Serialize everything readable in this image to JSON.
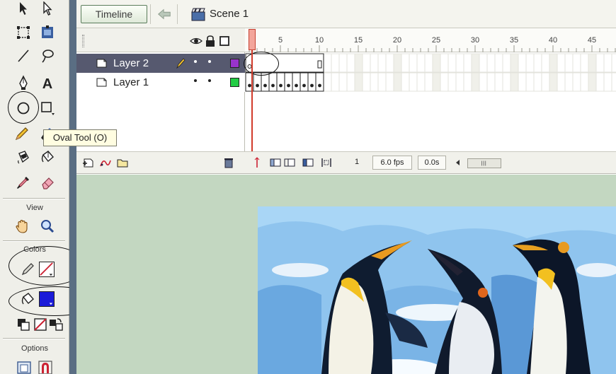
{
  "header": {
    "timeline_button": "Timeline",
    "scene_label": "Scene 1"
  },
  "tools": {
    "items": [
      {
        "name": "arrow-tool-icon"
      },
      {
        "name": "subselect-tool-icon"
      },
      {
        "name": "free-transform-tool-icon"
      },
      {
        "name": "fill-transform-tool-icon"
      },
      {
        "name": "line-tool-icon"
      },
      {
        "name": "lasso-tool-icon"
      },
      {
        "name": "pen-tool-icon"
      },
      {
        "name": "text-tool-icon"
      },
      {
        "name": "oval-tool-icon"
      },
      {
        "name": "rectangle-tool-icon"
      },
      {
        "name": "pencil-tool-icon"
      },
      {
        "name": "brush-tool-icon"
      },
      {
        "name": "ink-bottle-tool-icon"
      },
      {
        "name": "paint-bucket-tool-icon"
      },
      {
        "name": "eyedropper-tool-icon"
      },
      {
        "name": "eraser-tool-icon"
      }
    ],
    "tooltip": "Oval Tool (O)",
    "view_label": "View",
    "colors_label": "Colors",
    "options_label": "Options",
    "stroke_color": "#cc2233",
    "fill_color": "#1a1ad8"
  },
  "timeline": {
    "layers": [
      {
        "name": "Layer 2",
        "selected": true,
        "color": "#9933cc"
      },
      {
        "name": "Layer 1",
        "selected": false,
        "color": "#22cc44"
      }
    ],
    "frame_numbers": [
      "5",
      "10",
      "15",
      "20",
      "25",
      "30",
      "35",
      "40",
      "45"
    ],
    "current_frame": "1",
    "frame_rate": "6.0 fps",
    "elapsed_time": "0.0s"
  },
  "colors": {
    "selected_layer_bg": "#56596f",
    "stage_bg": "#c3d7c1",
    "playhead": "#d23b2b"
  }
}
